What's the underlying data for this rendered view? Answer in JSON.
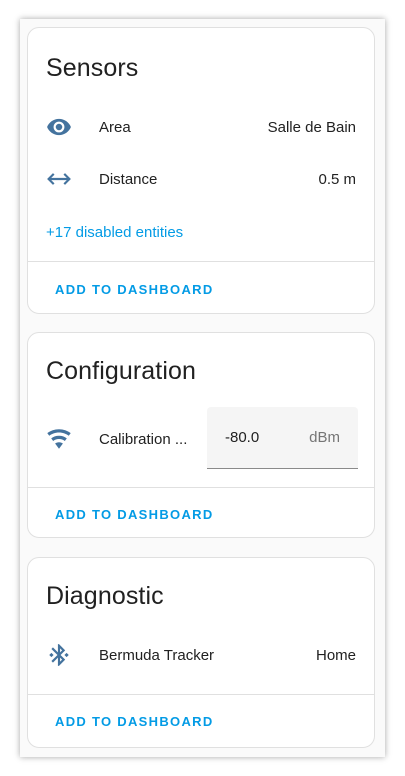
{
  "sensors": {
    "title": "Sensors",
    "rows": [
      {
        "icon": "eye-icon",
        "label": "Area",
        "value": "Salle de Bain"
      },
      {
        "icon": "arrow-left-right-icon",
        "label": "Distance",
        "value": "0.5 m"
      }
    ],
    "disabled_link": "+17 disabled entities",
    "action": "ADD TO DASHBOARD"
  },
  "configuration": {
    "title": "Configuration",
    "row": {
      "icon": "wifi-icon",
      "label": "Calibration ...",
      "value": "-80.0",
      "unit": "dBm"
    },
    "action": "ADD TO DASHBOARD"
  },
  "diagnostic": {
    "title": "Diagnostic",
    "row": {
      "icon": "bluetooth-icon",
      "label": "Bermuda Tracker",
      "value": "Home"
    },
    "action": "ADD TO DASHBOARD"
  },
  "colors": {
    "icon": "#44739e",
    "accent": "#039be5",
    "text": "#212121"
  }
}
